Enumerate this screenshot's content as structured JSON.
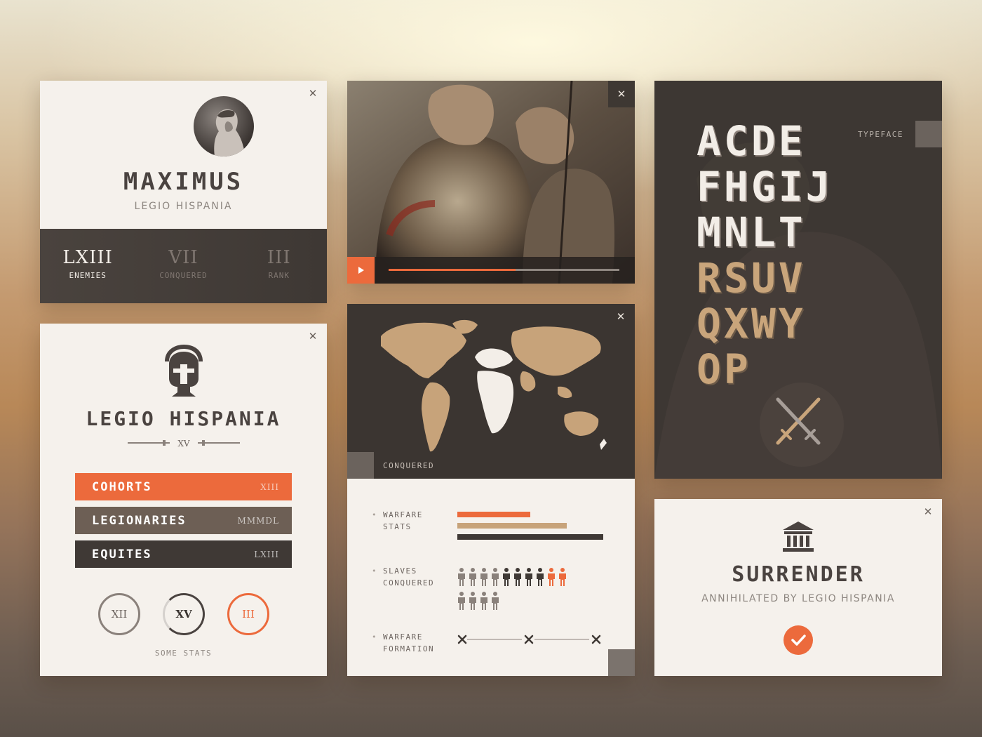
{
  "colors": {
    "accent": "#ec6a3c",
    "dark": "#3f3935",
    "tan": "#c7a37a",
    "card": "#f5f1ec"
  },
  "profile": {
    "name": "MAXIMUS",
    "legion": "LEGIO HISPANIA",
    "stats": [
      {
        "value": "LXIII",
        "label": "ENEMIES"
      },
      {
        "value": "VII",
        "label": "CONQUERED"
      },
      {
        "value": "III",
        "label": "RANK"
      }
    ]
  },
  "video": {
    "progress": 0.55,
    "buffered": 0.55
  },
  "typeface": {
    "label": "TYPEFACE",
    "rows": [
      "ACDE",
      "FHGIJ",
      "MNLT",
      "RSUV",
      "QXWY",
      "OP"
    ]
  },
  "legion": {
    "title": "LEGIO HISPANIA",
    "number": "XV",
    "units": [
      {
        "label": "COHORTS",
        "value": "XIII"
      },
      {
        "label": "LEGIONARIES",
        "value": "MMMDL"
      },
      {
        "label": "EQUITES",
        "value": "LXIII"
      }
    ],
    "rings": [
      "XII",
      "XV",
      "III"
    ],
    "footer": "SOME STATS"
  },
  "map": {
    "label": "CONQUERED",
    "warfare_stats_label": [
      "WARFARE",
      "STATS"
    ],
    "slaves_label": [
      "SLAVES",
      "CONQUERED"
    ],
    "formation_label": [
      "WARFARE",
      "FORMATION"
    ],
    "bars": [
      {
        "value": 0.5,
        "color": "#ec6a3c"
      },
      {
        "value": 0.75,
        "color": "#c7a37a"
      },
      {
        "value": 1.0,
        "color": "#3f3935"
      }
    ],
    "slaves": {
      "total": 14,
      "orange": 2
    }
  },
  "surrender": {
    "title": "SURRENDER",
    "subtitle": "ANNIHILATED BY LEGIO HISPANIA"
  }
}
